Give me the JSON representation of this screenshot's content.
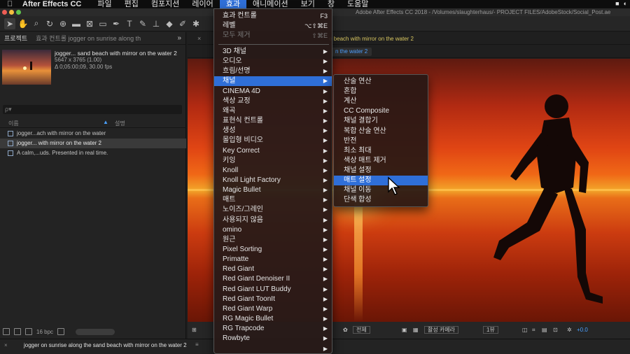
{
  "menubar": {
    "apple_icon": "apple-icon",
    "app_name": "After Effects CC",
    "items": [
      "파일",
      "편집",
      "컴포지션",
      "레이어",
      "효과",
      "애니메이션",
      "보기",
      "창",
      "도움말"
    ],
    "active_item": "효과"
  },
  "window": {
    "title": "Adobe After Effects CC 2018 - /Volumes/slaughterhaus/- PROJECT FILES/AdobeStock/Social_Post.ae"
  },
  "project_panel": {
    "tab_label": "프로젝트",
    "effects_tab_label": "효과 컨트롤  jogger on sunrise along th",
    "item_name": "jogger... sand beach with mirror on the water 2",
    "item_dims": "5647 x 3765 (1.00)",
    "item_duration": "Δ 0;05:00;09, 30.00 fps",
    "search_placeholder": "ρ▾",
    "col_name": "이름",
    "col_desc": "설명",
    "rows": [
      {
        "label": "jogger...ach with mirror on the water",
        "selected": false
      },
      {
        "label": "jogger... with mirror on the water 2",
        "selected": true
      },
      {
        "label": "A calm,...uds. Presented in real time.",
        "selected": false
      }
    ],
    "bpc": "16 bpc"
  },
  "composition_panel": {
    "tab_label": "e beach with mirror on the water 2",
    "path_pill": "n the water 2",
    "bottom_view": "전체",
    "bottom_camera": "활성 카메라",
    "bottom_views": "1뷰",
    "exposure": "+0.0"
  },
  "timeline": {
    "comp_name": "jogger on sunrise along the sand beach with mirror on the water 2"
  },
  "effects_menu": {
    "rows": [
      {
        "label": "효과 컨트롤",
        "shortcut": "F3",
        "type": "cmd"
      },
      {
        "label": "레벨",
        "shortcut": "⌥⇧⌘E",
        "type": "cmd"
      },
      {
        "label": "모두 제거",
        "shortcut": "⇧⌘E",
        "type": "disabled"
      },
      {
        "label": "3D 채널",
        "type": "sub"
      },
      {
        "label": "오디오",
        "type": "sub"
      },
      {
        "label": "흐림/선명",
        "type": "sub"
      },
      {
        "label": "채널",
        "type": "sub",
        "highlight": true
      },
      {
        "label": "CINEMA 4D",
        "type": "sub"
      },
      {
        "label": "색상 교정",
        "type": "sub"
      },
      {
        "label": "왜곡",
        "type": "sub"
      },
      {
        "label": "표현식 컨트롤",
        "type": "sub"
      },
      {
        "label": "생성",
        "type": "sub"
      },
      {
        "label": "몰입형 비디오",
        "type": "sub"
      },
      {
        "label": "Key Correct",
        "type": "sub"
      },
      {
        "label": "키잉",
        "type": "sub"
      },
      {
        "label": "Knoll",
        "type": "sub"
      },
      {
        "label": "Knoll Light Factory",
        "type": "sub"
      },
      {
        "label": "Magic Bullet",
        "type": "sub"
      },
      {
        "label": "매트",
        "type": "sub"
      },
      {
        "label": "노이즈/그레인",
        "type": "sub"
      },
      {
        "label": "사용되지 않음",
        "type": "sub"
      },
      {
        "label": "omino",
        "type": "sub"
      },
      {
        "label": "원근",
        "type": "sub"
      },
      {
        "label": "Pixel Sorting",
        "type": "sub"
      },
      {
        "label": "Primatte",
        "type": "sub"
      },
      {
        "label": "Red Giant",
        "type": "sub"
      },
      {
        "label": "Red Giant Denoiser II",
        "type": "sub"
      },
      {
        "label": "Red Giant LUT Buddy",
        "type": "sub"
      },
      {
        "label": "Red Giant ToonIt",
        "type": "sub"
      },
      {
        "label": "Red Giant Warp",
        "type": "sub"
      },
      {
        "label": "RG Magic Bullet",
        "type": "sub"
      },
      {
        "label": "RG Trapcode",
        "type": "sub"
      },
      {
        "label": "Rowbyte",
        "type": "sub"
      },
      {
        "label": "",
        "type": "sub"
      }
    ]
  },
  "channel_menu": {
    "rows": [
      {
        "label": "산술 연산"
      },
      {
        "label": "혼합"
      },
      {
        "label": "계산"
      },
      {
        "label": "CC Composite"
      },
      {
        "label": "채널 결합기"
      },
      {
        "label": "복합 산술 연산"
      },
      {
        "label": "반전"
      },
      {
        "label": "최소 최대"
      },
      {
        "label": "색상 매트 제거"
      },
      {
        "label": "채널 설정"
      },
      {
        "label": "매트 설정",
        "highlight": true
      },
      {
        "label": "채널 이동"
      },
      {
        "label": "단색 합성"
      }
    ]
  },
  "colors": {
    "accent": "#2f6fd8",
    "comp_tab_yellow": "#d8c660",
    "link_blue": "#4d9fff"
  }
}
